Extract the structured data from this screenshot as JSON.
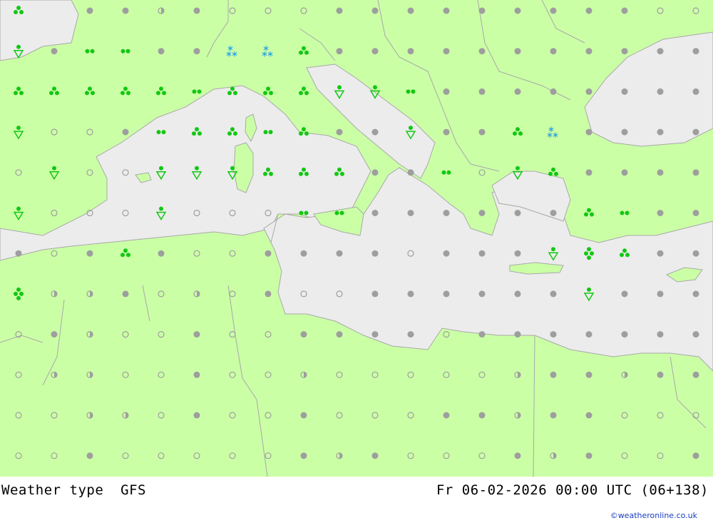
{
  "map": {
    "title": "Weather type",
    "model": "GFS",
    "valid_time": "Fr 06-02-2026 00:00 UTC (06+138)",
    "credit": "©weatheronline.co.uk",
    "colors": {
      "land": "#cbffa6",
      "sea": "#ececec",
      "border": "#a8a8a8",
      "dot": "#9e9e9e",
      "rain": "#12c812",
      "snow": "#1e9be8"
    }
  },
  "grid": {
    "columns": 20,
    "rows": 12,
    "rows_data": [
      "g r d d h d i i i d d d d d d d d d i i",
      "V d R R d d S S T d d d d d d d d d d d",
      "T T T T T R T T T V V R d d d d d d d d",
      "V i i d R T T R T d d V d d T S d d d d",
      "i V i i V V V T T T d d R i V T d d d d",
      "V i i i V i i i R R d d d d d d T R d d",
      "d i d T d i i d d d d i d d d V Q T d d",
      "Q h h d i h i d i i d d d d d d V d d d",
      "i d h i i d i i d d d d i d d d d d d d",
      "i h h i i d i i h i i i i i h d d h d d",
      "i i h h i d i i d i i i d d h d d i i i",
      "i i d i i i i i d h d i i i d h d i i d"
    ],
    "legend": {
      "d": "dry (filled dot)",
      "h": "half-filled dot",
      "i": "empty circle",
      "R": "rain (double dot)",
      "T": "rain (triple dot)",
      "Q": "heavy rain cluster",
      "V": "rain shower",
      "S": "snow",
      "g": "rain (triangle cluster)"
    }
  }
}
